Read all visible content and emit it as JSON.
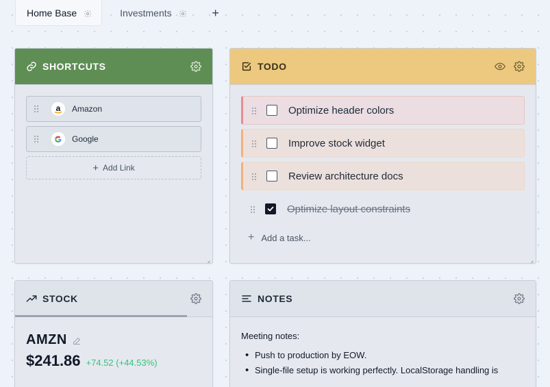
{
  "tabs": [
    {
      "label": "Home Base",
      "active": true
    },
    {
      "label": "Investments",
      "active": false
    }
  ],
  "tab_add_label": "+",
  "shortcuts": {
    "title": "SHORTCUTS",
    "links": [
      {
        "label": "Amazon",
        "icon": "amazon-icon"
      },
      {
        "label": "Google",
        "icon": "google-icon"
      }
    ],
    "add_label": "Add Link",
    "color": "#5f8e55"
  },
  "todo": {
    "title": "TODO",
    "tasks": [
      {
        "text": "Optimize header colors",
        "done": false,
        "priority_color": "#e88a8f"
      },
      {
        "text": "Improve stock widget",
        "done": false,
        "priority_color": "#f3b07a"
      },
      {
        "text": "Review architecture docs",
        "done": false,
        "priority_color": "#f3b07a"
      },
      {
        "text": "Optimize layout constraints",
        "done": true
      }
    ],
    "add_placeholder": "Add a task...",
    "color": "#ecc97f"
  },
  "stock": {
    "title": "STOCK",
    "ticker": "AMZN",
    "price": "$241.86",
    "change": "+74.52 (+44.53%)",
    "change_color": "#34c37c"
  },
  "notes": {
    "title": "NOTES",
    "heading": "Meeting notes:",
    "bullets": [
      "Push to production by EOW.",
      "Single-file setup is working perfectly. LocalStorage handling is"
    ]
  }
}
